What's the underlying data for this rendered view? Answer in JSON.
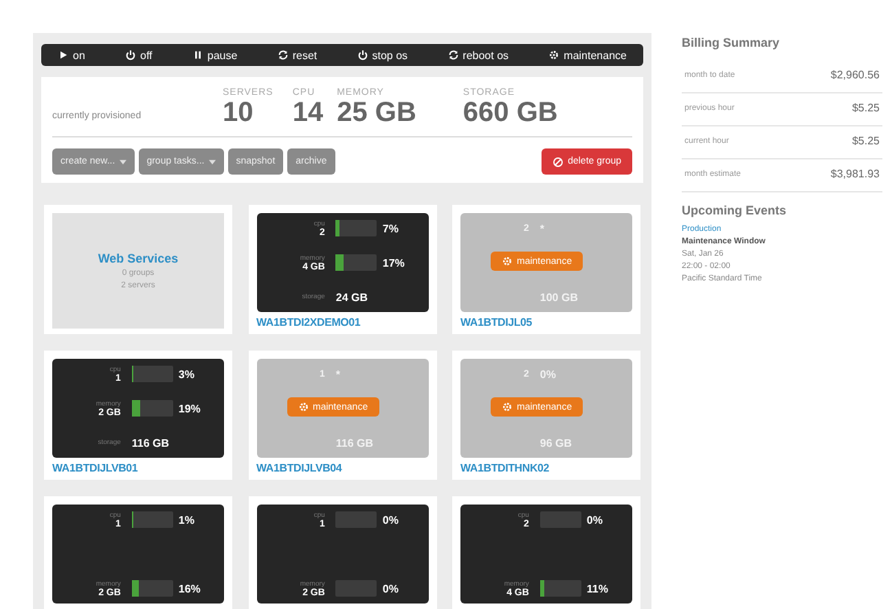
{
  "toolbar": [
    {
      "kind": "on",
      "label": "on"
    },
    {
      "kind": "off",
      "label": "off"
    },
    {
      "kind": "pause",
      "label": "pause"
    },
    {
      "kind": "reset",
      "label": "reset"
    },
    {
      "kind": "stop",
      "label": "stop os"
    },
    {
      "kind": "reboot",
      "label": "reboot os"
    },
    {
      "kind": "maintenance",
      "label": "maintenance"
    }
  ],
  "summary": {
    "caption": "currently provisioned",
    "stats": [
      {
        "label": "SERVERS",
        "value": "10"
      },
      {
        "label": "CPU",
        "value": "14"
      },
      {
        "label": "MEMORY",
        "value": "25 GB"
      },
      {
        "label": "STORAGE",
        "value": "660 GB"
      }
    ]
  },
  "actions": [
    {
      "kind": "menu",
      "label": "create new..."
    },
    {
      "kind": "menu",
      "label": "group tasks..."
    },
    {
      "kind": "plain",
      "label": "snapshot"
    },
    {
      "kind": "plain",
      "label": "archive"
    },
    {
      "kind": "danger",
      "label": "delete group"
    }
  ],
  "cards": [
    {
      "kind": "group",
      "title": "Web Services",
      "lines": [
        "0 groups",
        "2 servers"
      ]
    },
    {
      "kind": "server",
      "maintenance": false,
      "name": "WA1BTDI2XDEMO01",
      "cpu": {
        "label": "cpu",
        "count": "2",
        "percent": "7%",
        "level": 0.07
      },
      "memory": {
        "label": "memory",
        "amount": "4 GB",
        "percent": "17%",
        "level": 0.17
      },
      "storage": {
        "label": "storage",
        "amount": "24 GB"
      }
    },
    {
      "kind": "server",
      "maintenance": true,
      "badge": "maintenance",
      "name": "WA1BTDIJL05",
      "cpu": {
        "count": "2",
        "percent": "*"
      },
      "storage": {
        "amount": "100 GB"
      }
    },
    {
      "kind": "server",
      "maintenance": false,
      "name": "WA1BTDIJLVB01",
      "cpu": {
        "label": "cpu",
        "count": "1",
        "percent": "3%",
        "level": 0.03
      },
      "memory": {
        "label": "memory",
        "amount": "2 GB",
        "percent": "19%",
        "level": 0.19
      },
      "storage": {
        "label": "storage",
        "amount": "116 GB"
      }
    },
    {
      "kind": "server",
      "maintenance": true,
      "badge": "maintenance",
      "name": "WA1BTDIJLVB04",
      "cpu": {
        "count": "1",
        "percent": "*"
      },
      "storage": {
        "amount": "116 GB"
      }
    },
    {
      "kind": "server",
      "maintenance": true,
      "badge": "maintenance",
      "name": "WA1BTDITHNK02",
      "cpu": {
        "count": "2",
        "percent": "0%"
      },
      "storage": {
        "amount": "96 GB"
      }
    },
    {
      "kind": "server",
      "maintenance": false,
      "cpu": {
        "label": "cpu",
        "count": "1",
        "percent": "1%",
        "level": 0.01
      },
      "memory": {
        "label": "memory",
        "amount": "2 GB",
        "percent": "16%",
        "level": 0.16
      }
    },
    {
      "kind": "server",
      "maintenance": false,
      "cpu": {
        "label": "cpu",
        "count": "1",
        "percent": "0%",
        "level": 0
      },
      "memory": {
        "label": "memory",
        "amount": "2 GB",
        "percent": "0%",
        "level": 0
      }
    },
    {
      "kind": "server",
      "maintenance": false,
      "cpu": {
        "label": "cpu",
        "count": "2",
        "percent": "0%",
        "level": 0
      },
      "memory": {
        "label": "memory",
        "amount": "4 GB",
        "percent": "11%",
        "level": 0.11
      }
    }
  ],
  "billing": {
    "title": "Billing Summary",
    "rows": [
      {
        "label": "month to date",
        "value": "$2,960.56"
      },
      {
        "label": "previous hour",
        "value": "$5.25"
      },
      {
        "label": "current hour",
        "value": "$5.25"
      },
      {
        "label": "month estimate",
        "value": "$3,981.93"
      }
    ]
  },
  "events": {
    "title": "Upcoming Events",
    "items": [
      {
        "category": "Production",
        "name": "Maintenance Window",
        "date": "Sat, Jan 26",
        "time": "22:00 - 02:00",
        "zone": "Pacific Standard Time"
      }
    ]
  }
}
